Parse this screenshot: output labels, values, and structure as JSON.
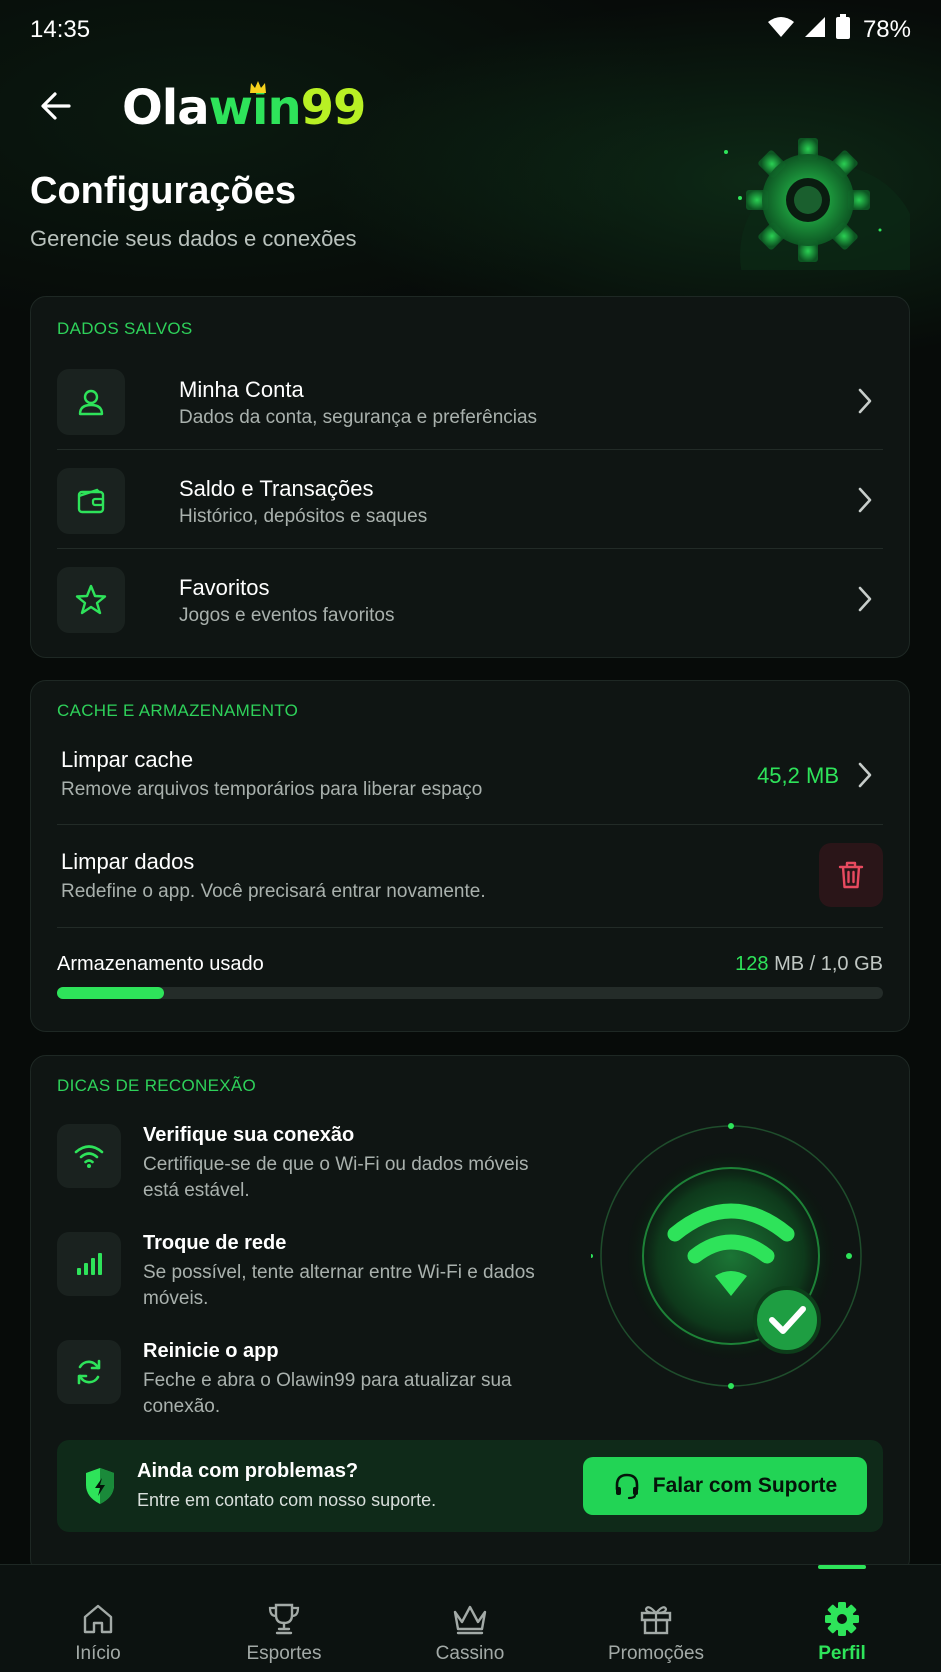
{
  "status_bar": {
    "time": "14:35",
    "battery": "78%"
  },
  "header": {
    "logo_parts": [
      "Ola",
      "win",
      "99"
    ],
    "title": "Configurações",
    "subtitle": "Gerencie seus dados e conexões"
  },
  "saved_data": {
    "title": "DADOS SALVOS",
    "items": [
      {
        "icon": "user-icon",
        "title": "Minha Conta",
        "subtitle": "Dados da conta, segurança e preferências"
      },
      {
        "icon": "wallet-icon",
        "title": "Saldo e Transações",
        "subtitle": "Histórico, depósitos e saques"
      },
      {
        "icon": "star-icon",
        "title": "Favoritos",
        "subtitle": "Jogos e eventos favoritos"
      }
    ]
  },
  "cache": {
    "title": "CACHE E ARMAZENAMENTO",
    "clear_cache": {
      "title": "Limpar cache",
      "subtitle": "Remove arquivos temporários para liberar espaço",
      "value": "45,2 MB"
    },
    "clear_data": {
      "title": "Limpar dados",
      "subtitle": "Redefine o app. Você precisará entrar novamente."
    },
    "storage": {
      "label": "Armazenamento usado",
      "used": "128",
      "rest": "MB / 1,0 GB",
      "fraction": 0.13
    }
  },
  "tips": {
    "title": "DICAS DE RECONEXÃO",
    "items": [
      {
        "icon": "wifi-icon",
        "title": "Verifique sua conexão",
        "text": "Certifique-se de que o Wi-Fi ou dados móveis está estável."
      },
      {
        "icon": "signal-bars-icon",
        "title": "Troque de rede",
        "text": "Se possível, tente alternar entre Wi-Fi e dados móveis."
      },
      {
        "icon": "refresh-icon",
        "title": "Reinicie o app",
        "text": "Feche e abra o Olawin99 para atualizar sua conexão."
      }
    ],
    "help": {
      "title": "Ainda com problemas?",
      "text": "Entre em contato com nosso suporte.",
      "button": "Falar com Suporte"
    }
  },
  "nav": {
    "items": [
      {
        "label": "Início",
        "icon": "home-icon"
      },
      {
        "label": "Esportes",
        "icon": "trophy-icon"
      },
      {
        "label": "Cassino",
        "icon": "crown-icon"
      },
      {
        "label": "Promoções",
        "icon": "gift-icon"
      },
      {
        "label": "Perfil",
        "icon": "gear-icon"
      }
    ],
    "active": "Perfil"
  },
  "colors": {
    "accent": "#2ee35a",
    "danger": "#e84a5f",
    "background": "#070b09",
    "card": "#0f1513"
  }
}
